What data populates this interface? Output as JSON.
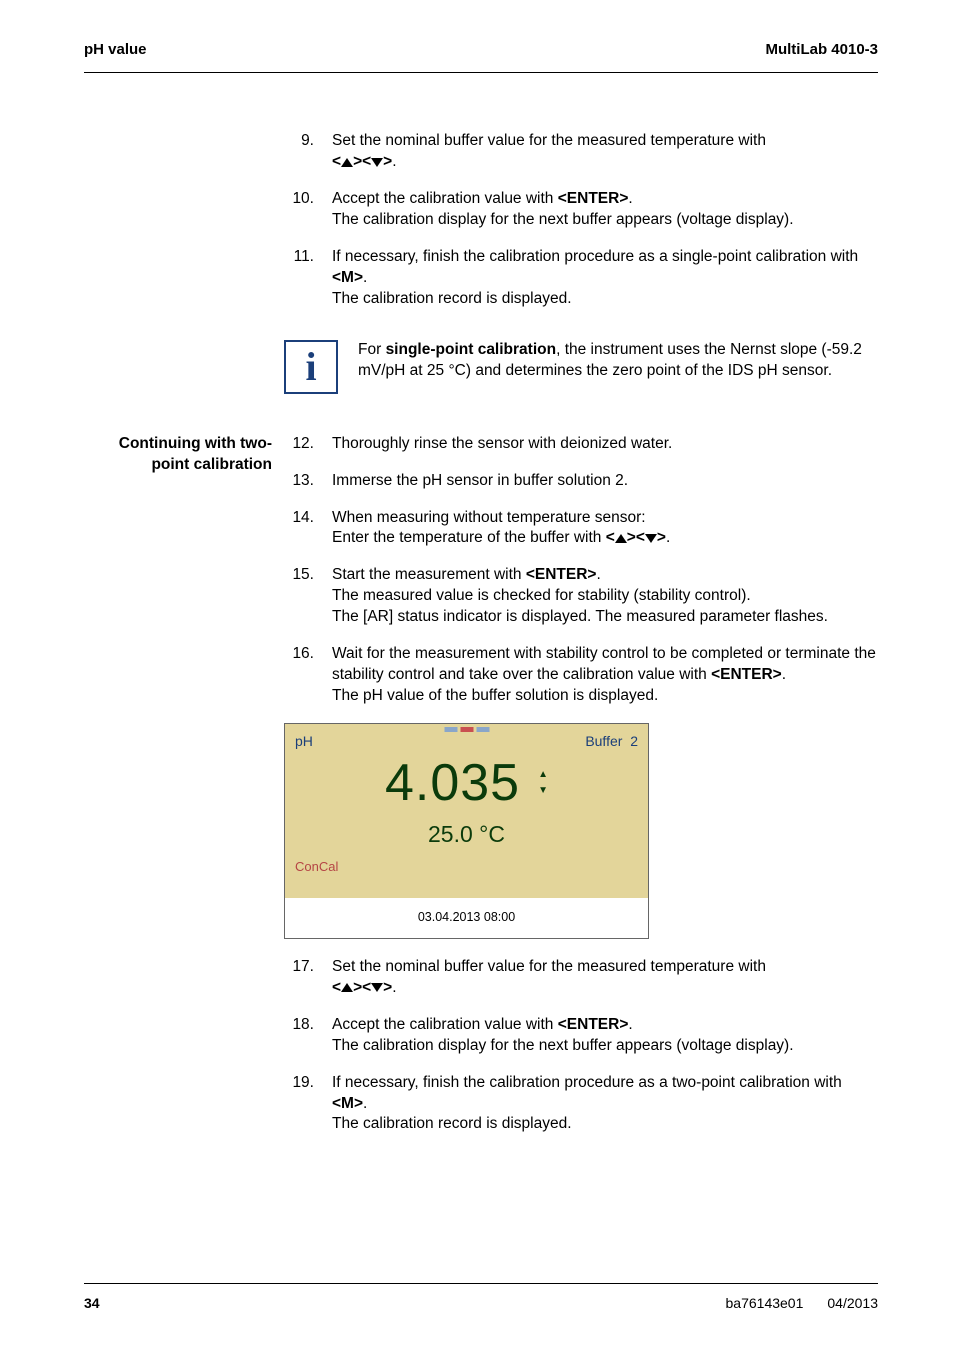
{
  "header": {
    "left": "pH value",
    "right": "MultiLab 4010-3"
  },
  "block1": {
    "steps": [
      {
        "num": "9.",
        "lines": [
          "Set the nominal buffer value for the measured temperature with "
        ],
        "keyseq": true
      },
      {
        "num": "10.",
        "text": "Accept the calibration value with ",
        "key": "<ENTER>",
        "after": ".<br>The calibration display for the next buffer appears (voltage display)."
      },
      {
        "num": "11.",
        "text": "If necessary, finish the calibration procedure as a single-point calibration with ",
        "key": "<M>",
        "after": ".<br>The calibration record is displayed."
      }
    ]
  },
  "info": {
    "prefix": "For ",
    "bold": "single-point calibration",
    "rest": ", the instrument uses the Nernst slope (-59.2 mV/pH at 25 °C) and determines the zero point of the IDS pH sensor."
  },
  "sideLabel": "Continuing with two-point calibration",
  "block2": {
    "steps": [
      {
        "num": "12.",
        "text": "Thoroughly rinse the sensor with deionized water."
      },
      {
        "num": "13.",
        "text": "Immerse the pH sensor in buffer solution 2."
      },
      {
        "num": "14.",
        "text": "When measuring without temperature sensor:<br>Enter the temperature of the buffer with ",
        "keyseq": true
      },
      {
        "num": "15.",
        "text": "Start the measurement with ",
        "key": "<ENTER>",
        "after": ".<br>The measured value is checked for stability (stability control).<br>The [AR] status indicator is displayed. The measured parameter flashes."
      },
      {
        "num": "16.",
        "text": "Wait for the measurement with stability control to be completed or terminate the stability control and take over the calibration value with ",
        "key": "<ENTER>",
        "after": ".<br>The pH value of the buffer solution is displayed."
      }
    ]
  },
  "display": {
    "ph_label": "pH",
    "buffer_label": "Buffer",
    "buffer_num": "2",
    "value": "4.035",
    "temp": "25.0 °C",
    "concal": "ConCal",
    "timestamp": "03.04.2013 08:00"
  },
  "block3": {
    "steps": [
      {
        "num": "17.",
        "lines": [
          "Set the nominal buffer value for the measured temperature with "
        ],
        "keyseq": true
      },
      {
        "num": "18.",
        "text": "Accept the calibration value with ",
        "key": "<ENTER>",
        "after": ".<br>The calibration display for the next buffer appears (voltage display)."
      },
      {
        "num": "19.",
        "text": "If necessary, finish the calibration procedure as a two-point calibration with ",
        "key": "<M>",
        "after": ".<br>The calibration record is displayed."
      }
    ]
  },
  "footer": {
    "page": "34",
    "docid": "ba76143e01",
    "date": "04/2013"
  }
}
